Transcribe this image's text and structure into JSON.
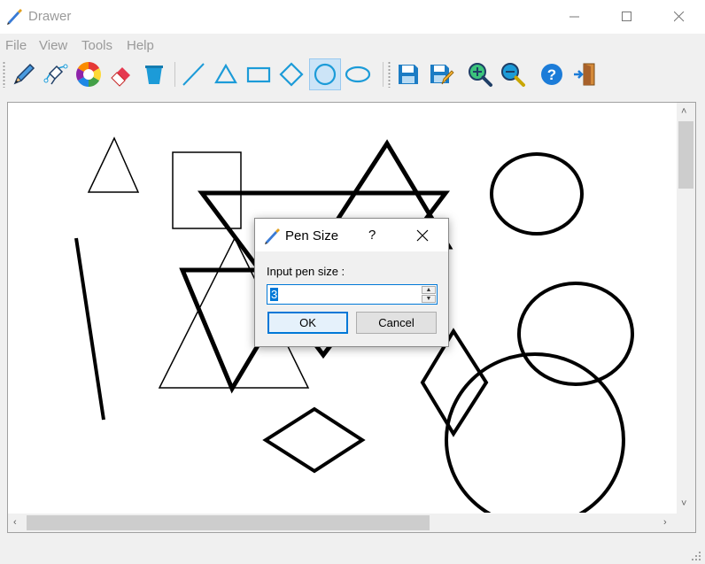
{
  "window": {
    "title": "Drawer"
  },
  "menu": {
    "items": [
      "File",
      "View",
      "Tools",
      "Help"
    ]
  },
  "toolbar": {
    "tools": [
      {
        "name": "pencil-icon"
      },
      {
        "name": "bezier-pen-icon"
      },
      {
        "name": "color-wheel-icon"
      },
      {
        "name": "eraser-icon"
      },
      {
        "name": "bucket-icon"
      },
      {
        "name": "line-icon"
      },
      {
        "name": "triangle-icon"
      },
      {
        "name": "rectangle-icon"
      },
      {
        "name": "diamond-icon"
      },
      {
        "name": "circle-icon",
        "active": true
      },
      {
        "name": "ellipse-icon"
      },
      {
        "name": "save-icon"
      },
      {
        "name": "save-as-icon"
      },
      {
        "name": "zoom-in-icon"
      },
      {
        "name": "zoom-out-icon"
      },
      {
        "name": "help-icon"
      },
      {
        "name": "exit-icon"
      }
    ]
  },
  "dialog": {
    "title": "Pen Size",
    "help_label": "?",
    "prompt": "Input pen size :",
    "value": "3",
    "ok_label": "OK",
    "cancel_label": "Cancel"
  },
  "colors": {
    "accent": "#0078d7",
    "toolbar_blue": "#1c9bd8",
    "selection": "#cce4f7"
  }
}
